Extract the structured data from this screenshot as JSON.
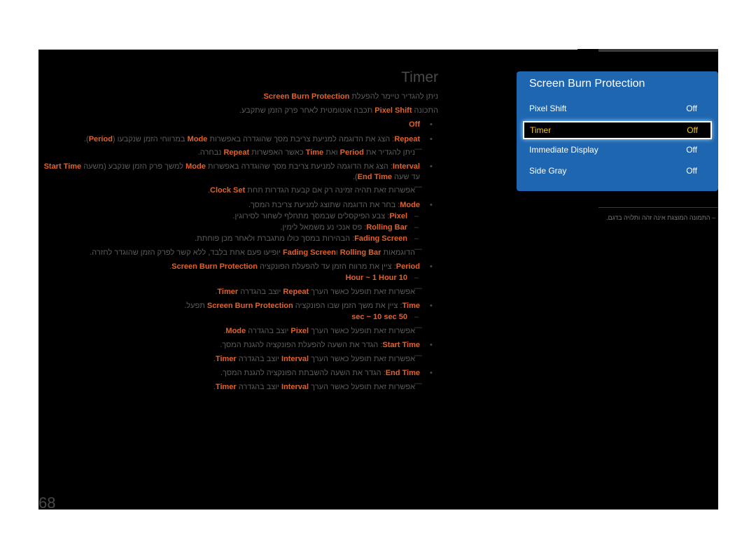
{
  "title": "Timer",
  "lines": [
    {
      "kind": "p",
      "segs": [
        {
          "t": "ניתן להגדיר טיימר להפעלת "
        },
        {
          "t": "Screen Burn Protection",
          "hl": true
        },
        {
          "t": "."
        }
      ]
    },
    {
      "kind": "p",
      "segs": [
        {
          "t": "התכונה "
        },
        {
          "t": "Pixel Shift",
          "hl": true
        },
        {
          "t": " תכבה אוטומטית לאחר פרק הזמן שתקבע."
        }
      ]
    },
    {
      "kind": "bullet",
      "segs": [
        {
          "t": "Off",
          "hl": true
        }
      ]
    },
    {
      "kind": "bullet",
      "segs": [
        {
          "t": "Repeat",
          "hl": true
        },
        {
          "t": ": הצג את הדוגמה למניעת צריבת מסך שהוגדרה באפשרות "
        },
        {
          "t": "Mode",
          "hl": true
        },
        {
          "t": " במרווחי הזמן שנקבעו ("
        },
        {
          "t": "Period",
          "hl": true
        },
        {
          "t": ")."
        }
      ]
    },
    {
      "kind": "note",
      "segs": [
        {
          "t": "ניתן להגדיר את "
        },
        {
          "t": "Period",
          "hl": true
        },
        {
          "t": " ואת "
        },
        {
          "t": "Time",
          "hl": true
        },
        {
          "t": " כאשר האפשרות "
        },
        {
          "t": "Repeat",
          "hl": true
        },
        {
          "t": " נבחרה."
        }
      ]
    },
    {
      "kind": "bullet",
      "segs": [
        {
          "t": "Interval",
          "hl": true
        },
        {
          "t": ": הצג את הדוגמה למניעת צריבת מסך שהוגדרה באפשרות "
        },
        {
          "t": "Mode",
          "hl": true
        },
        {
          "t": " למשך פרק הזמן שנקבע (משעה "
        },
        {
          "t": "Start Time",
          "hl": true
        }
      ]
    },
    {
      "kind": "cont",
      "segs": [
        {
          "t": "עד שעה "
        },
        {
          "t": "End Time",
          "hl": true
        },
        {
          "t": ")."
        }
      ]
    },
    {
      "kind": "note",
      "segs": [
        {
          "t": "אפשרות זאת תהיה זמינה רק אם קבעת הגדרות תחת "
        },
        {
          "t": "Clock Set",
          "hl": true
        },
        {
          "t": "."
        }
      ]
    },
    {
      "kind": "bullet",
      "segs": [
        {
          "t": "Mode",
          "hl": true
        },
        {
          "t": ": בחר את הדוגמה שתוצג למניעת צריבת המסך."
        }
      ]
    },
    {
      "kind": "sub",
      "segs": [
        {
          "t": "Pixel",
          "hl": true
        },
        {
          "t": ": צבע הפיקסלים שבמסך מתחלף לשחור לסירוגין."
        }
      ]
    },
    {
      "kind": "sub",
      "segs": [
        {
          "t": "Rolling Bar",
          "hl": true
        },
        {
          "t": ": פס אנכי נע משמאל לימין."
        }
      ]
    },
    {
      "kind": "sub",
      "segs": [
        {
          "t": "Fading Screen",
          "hl": true
        },
        {
          "t": ": הבהירות במסך כולו מתגברת ולאחר מכן פוחתת."
        }
      ]
    },
    {
      "kind": "note",
      "segs": [
        {
          "t": "הדוגמאות "
        },
        {
          "t": "Rolling Bar",
          "hl": true
        },
        {
          "t": " ו"
        },
        {
          "t": "Fading Screen",
          "hl": true
        },
        {
          "t": " יופיעו פעם אחת בלבד, ללא קשר לפרק הזמן שהוגדר לחזרה."
        }
      ]
    },
    {
      "kind": "bullet",
      "segs": [
        {
          "t": "Period",
          "hl": true
        },
        {
          "t": ": ציין את מרווח הזמן עד להפעלת הפונקציה "
        },
        {
          "t": "Screen Burn Protection",
          "hl": true
        },
        {
          "t": "."
        }
      ]
    },
    {
      "kind": "sub",
      "segs": [
        {
          "t": "10 Hour ~ 1 Hour",
          "hl": true
        }
      ]
    },
    {
      "kind": "note",
      "segs": [
        {
          "t": "אפשרות זאת תופעל כאשר הערך "
        },
        {
          "t": "Repeat",
          "hl": true
        },
        {
          "t": " יוצב בהגדרה "
        },
        {
          "t": "Timer",
          "hl": true
        },
        {
          "t": "."
        }
      ]
    },
    {
      "kind": "bullet",
      "segs": [
        {
          "t": "Time",
          "hl": true
        },
        {
          "t": ": ציין את משך הזמן שבו הפונקציה "
        },
        {
          "t": "Screen Burn Protection",
          "hl": true
        },
        {
          "t": " תפעל."
        }
      ]
    },
    {
      "kind": "sub",
      "segs": [
        {
          "t": "50 sec ~ 10 sec",
          "hl": true
        }
      ]
    },
    {
      "kind": "note",
      "segs": [
        {
          "t": "אפשרות זאת תופעל כאשר הערך "
        },
        {
          "t": "Pixel",
          "hl": true
        },
        {
          "t": " יוצב בהגדרה "
        },
        {
          "t": "Mode",
          "hl": true
        },
        {
          "t": "."
        }
      ]
    },
    {
      "kind": "bullet",
      "segs": [
        {
          "t": "Start Time",
          "hl": true
        },
        {
          "t": ": הגדר את השעה להפעלת הפונקציה להגנת המסך."
        }
      ]
    },
    {
      "kind": "note",
      "segs": [
        {
          "t": "אפשרות זאת תופעל כאשר הערך "
        },
        {
          "t": "Interval",
          "hl": true
        },
        {
          "t": " יוצב בהגדרה "
        },
        {
          "t": "Timer",
          "hl": true
        },
        {
          "t": "."
        }
      ]
    },
    {
      "kind": "bullet",
      "segs": [
        {
          "t": "End Time",
          "hl": true
        },
        {
          "t": ": הגדר את השעה להשבתת הפונקציה להגנת המסך."
        }
      ]
    },
    {
      "kind": "note",
      "segs": [
        {
          "t": "אפשרות זאת תופעל כאשר הערך "
        },
        {
          "t": "Interval",
          "hl": true
        },
        {
          "t": " יוצב בהגדרה "
        },
        {
          "t": "Timer",
          "hl": true
        },
        {
          "t": "."
        }
      ]
    }
  ],
  "menu": {
    "title": "Screen Burn Protection",
    "items": [
      {
        "label": "Pixel Shift",
        "value": "Off"
      },
      {
        "label": "Timer",
        "value": "Off",
        "selected": true
      },
      {
        "label": "Immediate Display",
        "value": "Off"
      },
      {
        "label": "Side Gray",
        "value": "Off"
      }
    ]
  },
  "caption": "– התמונה המוצגת אינה זהה ותלויה בדגם.",
  "page_number": "68",
  "colors": {
    "highlight": "#e0622a",
    "panel": "#1f66b1",
    "selected_text": "#f5c518"
  }
}
